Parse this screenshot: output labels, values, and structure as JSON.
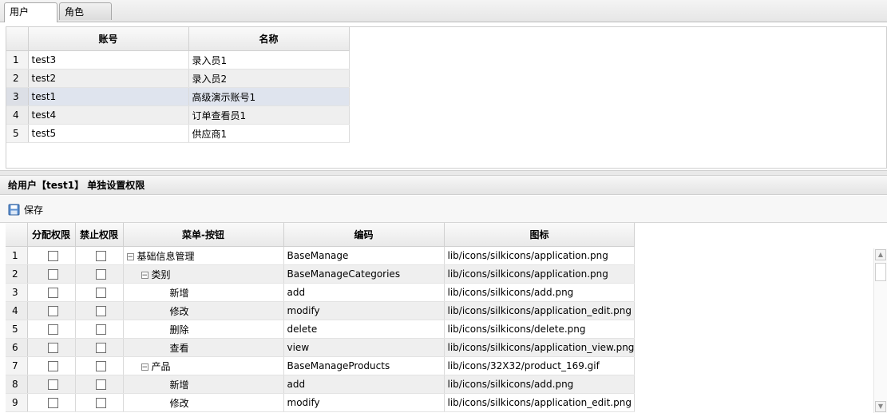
{
  "tabs": [
    {
      "label": "用户"
    },
    {
      "label": "角色"
    }
  ],
  "users_grid": {
    "columns": [
      "账号",
      "名称"
    ],
    "rows": [
      {
        "num": "1",
        "account": "test3",
        "name": "录入员1"
      },
      {
        "num": "2",
        "account": "test2",
        "name": "录入员2"
      },
      {
        "num": "3",
        "account": "test1",
        "name": "高级演示账号1"
      },
      {
        "num": "4",
        "account": "test4",
        "name": "订单查看员1"
      },
      {
        "num": "5",
        "account": "test5",
        "name": "供应商1"
      }
    ]
  },
  "permission_panel": {
    "title": "给用户【test1】 单独设置权限",
    "save_label": "保存",
    "columns": [
      "分配权限",
      "禁止权限",
      "菜单-按钮",
      "编码",
      "图标"
    ],
    "rows": [
      {
        "num": "1",
        "indent": 0,
        "toggle": "⊟",
        "menu": "基础信息管理",
        "code": "BaseManage",
        "icon_path": "lib/icons/silkicons/application.png"
      },
      {
        "num": "2",
        "indent": 1,
        "toggle": "⊟",
        "menu": "类别",
        "code": "BaseManageCategories",
        "icon_path": "lib/icons/silkicons/application.png"
      },
      {
        "num": "3",
        "indent": 2,
        "toggle": "",
        "menu": "新增",
        "code": "add",
        "icon_path": "lib/icons/silkicons/add.png"
      },
      {
        "num": "4",
        "indent": 2,
        "toggle": "",
        "menu": "修改",
        "code": "modify",
        "icon_path": "lib/icons/silkicons/application_edit.png"
      },
      {
        "num": "5",
        "indent": 2,
        "toggle": "",
        "menu": "删除",
        "code": "delete",
        "icon_path": "lib/icons/silkicons/delete.png"
      },
      {
        "num": "6",
        "indent": 2,
        "toggle": "",
        "menu": "查看",
        "code": "view",
        "icon_path": "lib/icons/silkicons/application_view.png"
      },
      {
        "num": "7",
        "indent": 1,
        "toggle": "⊟",
        "menu": "产品",
        "code": "BaseManageProducts",
        "icon_path": "lib/icons/32X32/product_169.gif"
      },
      {
        "num": "8",
        "indent": 2,
        "toggle": "",
        "menu": "新增",
        "code": "add",
        "icon_path": "lib/icons/silkicons/add.png"
      },
      {
        "num": "9",
        "indent": 2,
        "toggle": "",
        "menu": "修改",
        "code": "modify",
        "icon_path": "lib/icons/silkicons/application_edit.png"
      }
    ]
  },
  "icons": {
    "save": "save-icon",
    "tree_collapse": "minus-box-icon",
    "scroll_up": "arrow-up-icon",
    "scroll_down": "arrow-down-icon"
  }
}
